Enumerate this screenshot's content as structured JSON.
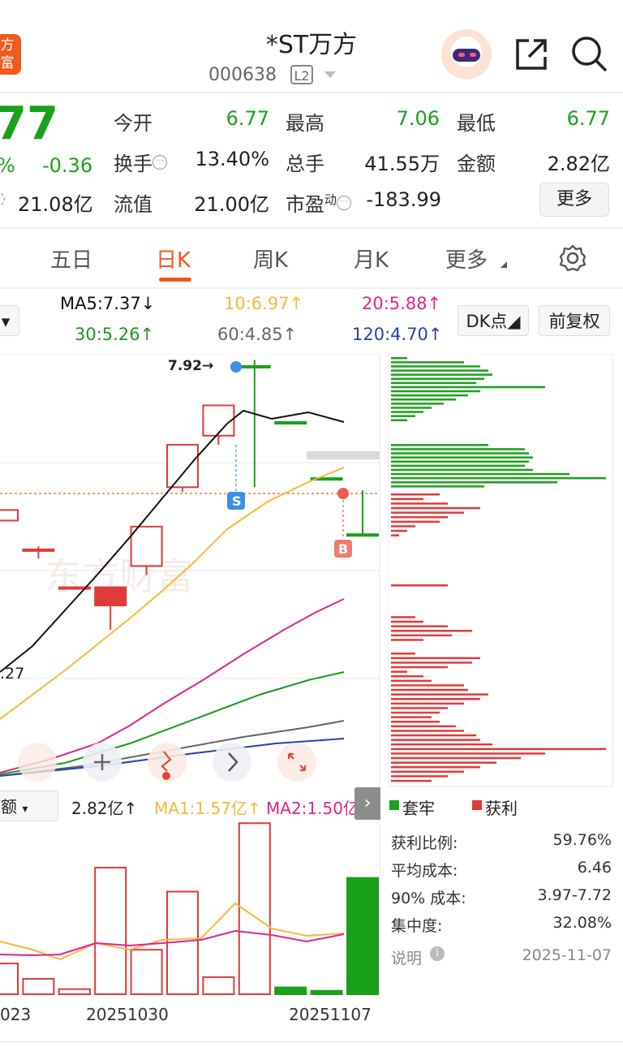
{
  "header": {
    "logo_text": "方\n富",
    "title": "*ST万方",
    "code": "000638",
    "level_badge": "L2",
    "icons": [
      "share-icon",
      "search-icon"
    ]
  },
  "quote": {
    "price": "77",
    "change_pct": "%",
    "change": "-0.36",
    "market_cap": "21.08亿",
    "fields": [
      {
        "label": "今开",
        "value": "6.77",
        "color": "green"
      },
      {
        "label": "最高",
        "value": "7.06",
        "color": "green"
      },
      {
        "label": "最低",
        "value": "6.77",
        "color": "green"
      },
      {
        "label": "换手",
        "value": "13.40%",
        "color": "dark"
      },
      {
        "label": "总手",
        "value": "41.55万",
        "color": "dark"
      },
      {
        "label": "金额",
        "value": "2.82亿",
        "color": "dark"
      },
      {
        "label": "流值",
        "value": "21.00亿",
        "color": "dark"
      },
      {
        "label": "市盈",
        "sup": "动",
        "value": "-183.99",
        "color": "dark"
      }
    ],
    "more_label": "更多"
  },
  "tabs": [
    {
      "label": "五日",
      "active": false
    },
    {
      "label": "日K",
      "active": true
    },
    {
      "label": "周K",
      "active": false
    },
    {
      "label": "月K",
      "active": false
    },
    {
      "label": "更多",
      "active": false
    }
  ],
  "ma_legend": {
    "ma5": "MA5:7.37↓",
    "ma10": "10:6.97↑",
    "ma20": "20:5.88↑",
    "ma30": "30:5.26↑",
    "ma60": "60:4.85↑",
    "ma120": "120:4.70↑",
    "dk_label": "DK点",
    "fq_label": "前复权"
  },
  "kline": {
    "high_label": "7.92→",
    "left_label": ".27",
    "sell_mark": "S",
    "buy_mark": "B",
    "watermark": "东方财富"
  },
  "volume": {
    "selector_label": "额",
    "amount": "2.82亿↑",
    "ma1": "MA1:1.57亿↑",
    "ma2": "MA2:1.50亿↑",
    "dates": [
      "023",
      "20251030",
      "20251107"
    ]
  },
  "chip": {
    "legend_trapped": "套牢",
    "legend_profit": "获利",
    "stats": [
      {
        "label": "获利比例:",
        "value": "59.76%"
      },
      {
        "label": "平均成本:",
        "value": "6.46"
      },
      {
        "label": "90% 成本:",
        "value": "3.97-7.72"
      },
      {
        "label": "集中度:",
        "value": "32.08%"
      }
    ],
    "note_label": "说明",
    "date": "2025-11-07"
  },
  "colors": {
    "up": "#e03a3a",
    "down": "#1aa11a",
    "accent": "#f25a1d",
    "ma5": "#111111",
    "ma10": "#f8b93a",
    "ma20": "#e0258f",
    "ma30": "#1c9a1c",
    "ma60": "#666666",
    "ma120": "#2c3fb0"
  },
  "chart_data": {
    "type": "candlestick",
    "candles": [
      {
        "o": 6.86,
        "c": 6.93,
        "h": 6.93,
        "l": 6.86
      },
      {
        "o": 6.67,
        "c": 6.67,
        "h": 6.69,
        "l": 6.61
      },
      {
        "o": 6.42,
        "c": 6.42,
        "h": 6.42,
        "l": 6.42
      },
      {
        "o": 6.3,
        "c": 6.42,
        "h": 6.42,
        "l": 6.14
      },
      {
        "o": 6.56,
        "c": 6.82,
        "h": 6.82,
        "l": 6.5
      },
      {
        "o": 7.08,
        "c": 7.36,
        "h": 7.36,
        "l": 7.05
      },
      {
        "o": 7.42,
        "c": 7.62,
        "h": 7.62,
        "l": 7.36
      },
      {
        "o": 7.88,
        "c": 7.88,
        "h": 7.92,
        "l": 7.08
      },
      {
        "o": 7.51,
        "c": 7.51,
        "h": 7.51,
        "l": 7.51
      },
      {
        "o": 7.14,
        "c": 7.14,
        "h": 7.14,
        "l": 7.14
      },
      {
        "o": 6.77,
        "c": 6.77,
        "h": 7.06,
        "l": 6.77
      }
    ],
    "volume": [
      0.9,
      0.45,
      0.15,
      3.7,
      1.3,
      3.0,
      0.5,
      5.0,
      0.2,
      0.1,
      3.4
    ],
    "volume_up": [
      true,
      true,
      true,
      true,
      true,
      true,
      true,
      true,
      false,
      false,
      false
    ]
  }
}
